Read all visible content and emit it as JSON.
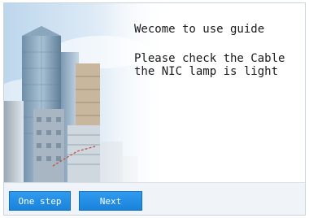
{
  "guide": {
    "welcome": "Wecome to use guide",
    "instruction_line1": "Please check the Cable",
    "instruction_line2": "the NIC lamp is light"
  },
  "buttons": {
    "one_step": "One step",
    "next": "Next"
  },
  "colors": {
    "button_blue": "#1a82dc",
    "sky_blue": "#bcd6ec"
  }
}
